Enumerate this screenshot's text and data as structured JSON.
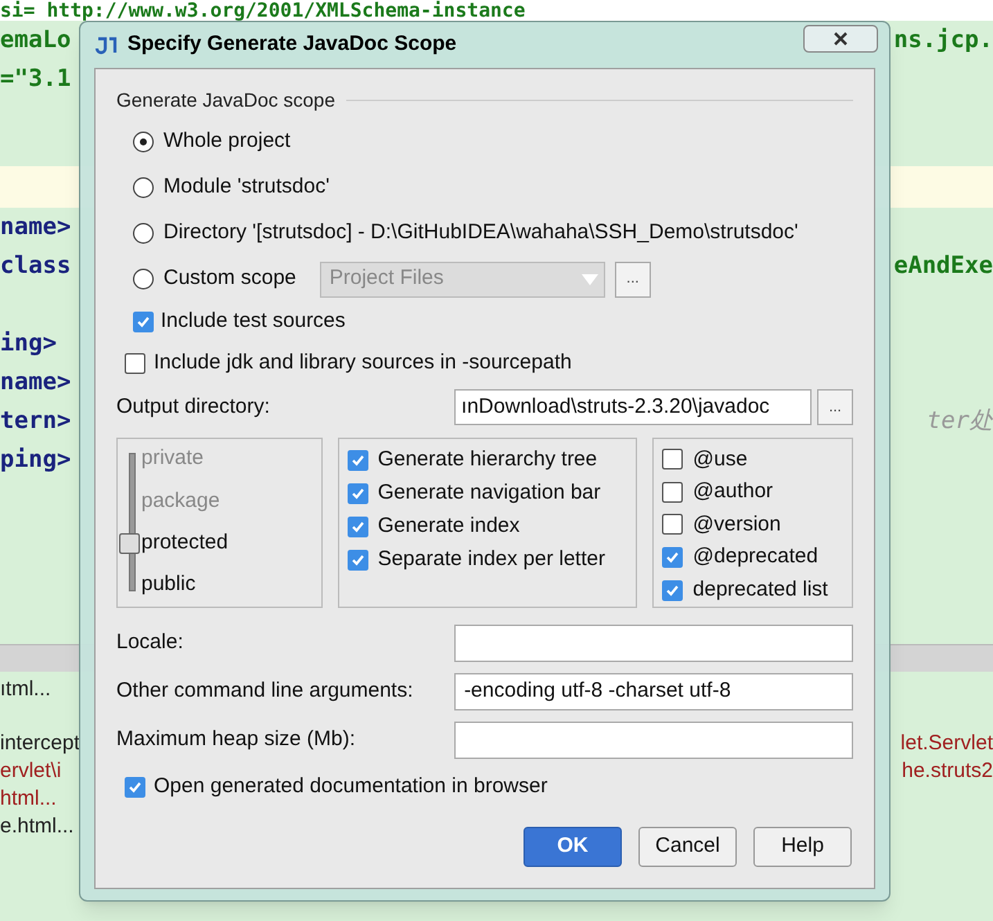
{
  "editor": {
    "lines": [
      {
        "left": "si= http://www.w3.org/2001/XMLSchema-instance"
      },
      {
        "left": "emaLo",
        "right": "ns.jcp."
      },
      {
        "left": "=\"3.1"
      },
      {
        "left": "name>"
      },
      {
        "left": "class",
        "right": "eAndExe"
      },
      {
        "left": "ing>"
      },
      {
        "left": "name>"
      },
      {
        "left": "tern>",
        "right": "ter处"
      },
      {
        "left": "ping>"
      }
    ],
    "bottom_lines": [
      {
        "left": "ıtml..."
      },
      {
        "left": "intercept",
        "right": "let.Servlet"
      },
      {
        "left": "ervlet\\i",
        "right": "he.struts2"
      },
      {
        "left": "html..."
      },
      {
        "left": "e.html..."
      }
    ]
  },
  "dialog": {
    "title": "Specify Generate JavaDoc Scope",
    "group_label": "Generate JavaDoc scope",
    "scopes": [
      {
        "label": "Whole project",
        "selected": true
      },
      {
        "label": "Module 'strutsdoc'",
        "selected": false
      },
      {
        "label": "Directory '[strutsdoc] - D:\\GitHubIDEA\\wahaha\\SSH_Demo\\strutsdoc'",
        "selected": false
      },
      {
        "label": "Custom scope",
        "selected": false
      }
    ],
    "scope_dropdown": {
      "value": "Project Files",
      "browse": "..."
    },
    "include_test": {
      "label": "Include test sources",
      "checked": true
    },
    "include_jdk": {
      "label": "Include jdk and library sources in -sourcepath",
      "checked": false
    },
    "output": {
      "label": "Output directory:",
      "value": "ınDownload\\struts-2.3.20\\javadoc",
      "browse": "..."
    },
    "visibility": [
      {
        "label": "private",
        "selected": false
      },
      {
        "label": "package",
        "selected": false
      },
      {
        "label": "protected",
        "selected": true
      },
      {
        "label": "public",
        "selected": false
      }
    ],
    "options": [
      {
        "label": "Generate hierarchy tree",
        "checked": true
      },
      {
        "label": "Generate navigation bar",
        "checked": true
      },
      {
        "label": "Generate index",
        "checked": true
      },
      {
        "label": "Separate index per letter",
        "checked": true
      }
    ],
    "tags": [
      {
        "label": "@use",
        "checked": false
      },
      {
        "label": "@author",
        "checked": false
      },
      {
        "label": "@version",
        "checked": false
      },
      {
        "label": "@deprecated",
        "checked": true
      },
      {
        "label": "deprecated list",
        "checked": true
      }
    ],
    "fields": [
      {
        "label": "Locale:"
      },
      {
        "label": "Other command line arguments:",
        "value": "-encoding utf-8 -charset utf-8"
      },
      {
        "label": "Maximum heap size (Mb):"
      }
    ],
    "open_browser": {
      "label": "Open generated documentation in browser",
      "checked": true
    },
    "buttons": [
      {
        "label": "OK",
        "primary": true
      },
      {
        "label": "Cancel",
        "primary": false
      },
      {
        "label": "Help",
        "primary": false
      }
    ]
  }
}
